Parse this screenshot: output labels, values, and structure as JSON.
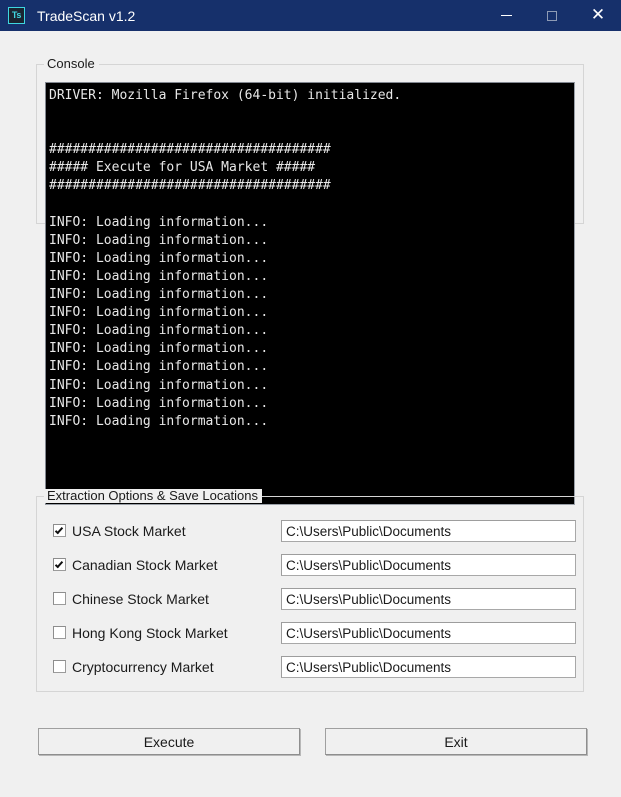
{
  "window": {
    "title": "TradeScan v1.2",
    "icon_label": "Ts",
    "icon_name": "tradescan-app-icon",
    "titlebar_color": "#16306B",
    "controls": {
      "minimize": "minimize-icon",
      "maximize": "maximize-icon",
      "close": "close-icon"
    }
  },
  "console": {
    "legend": "Console",
    "background": "#000000",
    "text_color": "#E8E8E8",
    "lines": [
      "DRIVER: Mozilla Firefox (64-bit) initialized.",
      "",
      "",
      "####################################",
      "##### Execute for USA Market #####",
      "####################################",
      "",
      "INFO: Loading information...",
      "INFO: Loading information...",
      "INFO: Loading information...",
      "INFO: Loading information...",
      "INFO: Loading information...",
      "INFO: Loading information...",
      "INFO: Loading information...",
      "INFO: Loading information...",
      "INFO: Loading information...",
      "INFO: Loading information...",
      "INFO: Loading information...",
      "INFO: Loading information..."
    ]
  },
  "options": {
    "legend": "Extraction Options & Save Locations",
    "rows": [
      {
        "label": "USA Stock Market",
        "checked": true,
        "path": "C:\\Users\\Public\\Documents",
        "placeholder": "C:\\Users\\Public\\Documents"
      },
      {
        "label": "Canadian Stock Market",
        "checked": true,
        "path": "C:\\Users\\Public\\Documents",
        "placeholder": "C:\\Users\\Public\\Documents"
      },
      {
        "label": "Chinese Stock Market",
        "checked": false,
        "path": "C:\\Users\\Public\\Documents",
        "placeholder": "C:\\Users\\Public\\Documents"
      },
      {
        "label": "Hong Kong Stock Market",
        "checked": false,
        "path": "C:\\Users\\Public\\Documents",
        "placeholder": "C:\\Users\\Public\\Documents"
      },
      {
        "label": "Cryptocurrency Market",
        "checked": false,
        "path": "C:\\Users\\Public\\Documents",
        "placeholder": "C:\\Users\\Public\\Documents"
      }
    ]
  },
  "actions": {
    "execute_label": "Execute",
    "exit_label": "Exit"
  }
}
